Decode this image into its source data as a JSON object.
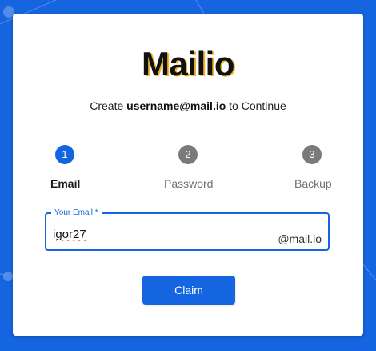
{
  "brand": {
    "name": "Mailio"
  },
  "subtitle": {
    "prefix": "Create ",
    "emphasis": "username@mail.io",
    "suffix": " to Continue"
  },
  "stepper": {
    "active_step": 1,
    "steps": [
      {
        "number": "1",
        "label": "Email"
      },
      {
        "number": "2",
        "label": "Password"
      },
      {
        "number": "3",
        "label": "Backup"
      }
    ]
  },
  "email_field": {
    "label": "Your Email *",
    "value": "igor27",
    "suffix": "@mail.io"
  },
  "actions": {
    "claim_label": "Claim"
  },
  "colors": {
    "background": "#1565e0",
    "accent": "#1565e0",
    "inactive_step": "#7a7a7a",
    "card": "#ffffff"
  }
}
